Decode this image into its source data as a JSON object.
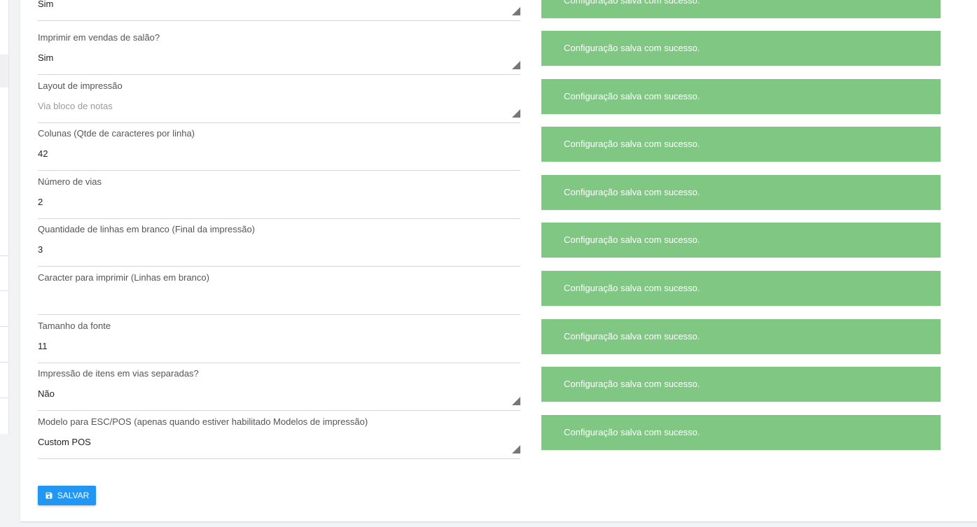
{
  "fields": [
    {
      "label": "",
      "value": "Sim",
      "placeholder": false,
      "select": true
    },
    {
      "label": "Imprimir em vendas de salão?",
      "value": "Sim",
      "placeholder": false,
      "select": true
    },
    {
      "label": "Layout de impressão",
      "value": "Via bloco de notas",
      "placeholder": true,
      "select": true
    },
    {
      "label": "Colunas (Qtde de caracteres por linha)",
      "value": "42",
      "placeholder": false,
      "select": false
    },
    {
      "label": "Número de vias",
      "value": "2",
      "placeholder": false,
      "select": false
    },
    {
      "label": "Quantidade de linhas em branco (Final da impressão)",
      "value": "3",
      "placeholder": false,
      "select": false
    },
    {
      "label": "Caracter para imprimir (Linhas em branco)",
      "value": "",
      "placeholder": false,
      "select": false
    },
    {
      "label": "Tamanho da fonte",
      "value": "11",
      "placeholder": false,
      "select": false
    },
    {
      "label": "Impressão de itens em vias separadas?",
      "value": "Não",
      "placeholder": false,
      "select": true
    },
    {
      "label": "Modelo para ESC/POS (apenas quando estiver habilitado Modelos de impressão)",
      "value": "Custom POS",
      "placeholder": false,
      "select": true
    }
  ],
  "notices": [
    "Configuração salva com sucesso.",
    "Configuração salva com sucesso.",
    "Configuração salva com sucesso.",
    "Configuração salva com sucesso.",
    "Configuração salva com sucesso.",
    "Configuração salva com sucesso.",
    "Configuração salva com sucesso.",
    "Configuração salva com sucesso.",
    "Configuração salva com sucesso.",
    "Configuração salva com sucesso."
  ],
  "save_button": {
    "label": "SALVAR",
    "icon": "floppy-disk-icon"
  },
  "colors": {
    "success": "#81c784",
    "primary": "#2196f3"
  }
}
